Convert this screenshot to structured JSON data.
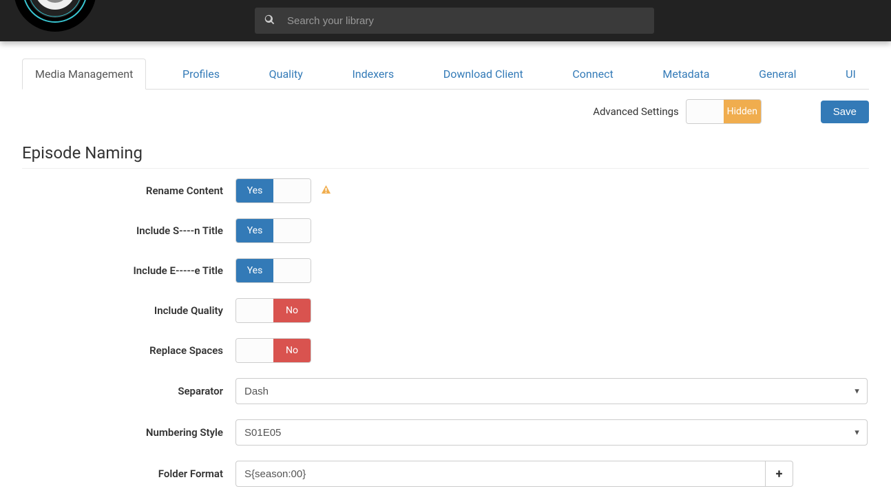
{
  "search": {
    "placeholder": "Search your library"
  },
  "tabs": [
    {
      "label": "Media Management",
      "active": true
    },
    {
      "label": "Profiles"
    },
    {
      "label": "Quality"
    },
    {
      "label": "Indexers"
    },
    {
      "label": "Download Client"
    },
    {
      "label": "Connect"
    },
    {
      "label": "Metadata"
    },
    {
      "label": "General"
    },
    {
      "label": "UI"
    }
  ],
  "advanced": {
    "label": "Advanced Settings",
    "state_label": "Hidden"
  },
  "save_label": "Save",
  "section_title": "Episode Naming",
  "toggle_labels": {
    "yes": "Yes",
    "no": "No"
  },
  "rows": {
    "rename_content": {
      "label": "Rename Content",
      "value": "yes",
      "warn": true
    },
    "include_s_title": {
      "label": "Include S----n Title",
      "value": "yes"
    },
    "include_e_title": {
      "label": "Include E-----e Title",
      "value": "yes"
    },
    "include_quality": {
      "label": "Include Quality",
      "value": "no"
    },
    "replace_spaces": {
      "label": "Replace Spaces",
      "value": "no"
    },
    "separator": {
      "label": "Separator",
      "value": "Dash"
    },
    "numbering_style": {
      "label": "Numbering Style",
      "value": "S01E05"
    },
    "folder_format": {
      "label": "Folder Format",
      "value": "S{season:00}"
    }
  }
}
